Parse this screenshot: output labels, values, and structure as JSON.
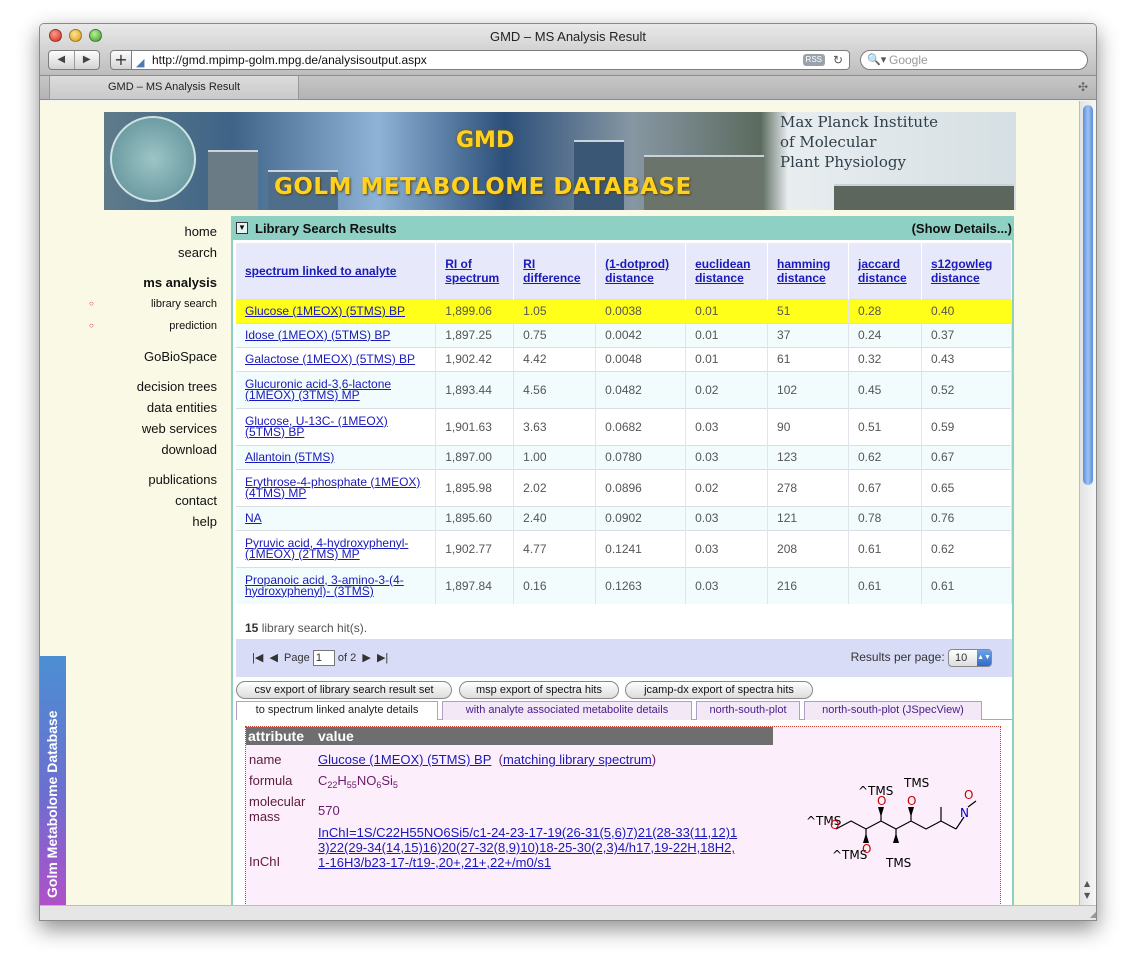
{
  "window": {
    "title": "GMD – MS Analysis Result",
    "url": "http://gmd.mpimp-golm.mpg.de/analysisoutput.aspx",
    "search_placeholder": "Google",
    "tab_label": "GMD – MS Analysis Result",
    "rss_label": "RSS"
  },
  "banner": {
    "title": "GMD",
    "subtitle": "GOLM METABOLOME DATABASE",
    "institute_line1": "Max Planck Institute",
    "institute_line2": "of Molecular",
    "institute_line3": "Plant Physiology"
  },
  "sidebar": {
    "items": [
      {
        "label": "home"
      },
      {
        "label": "search"
      },
      {
        "label": "ms analysis"
      },
      {
        "label": "library search"
      },
      {
        "label": "prediction"
      },
      {
        "label": "GoBioSpace"
      },
      {
        "label": "decision trees"
      },
      {
        "label": "data entities"
      },
      {
        "label": "web services"
      },
      {
        "label": "download"
      },
      {
        "label": "publications"
      },
      {
        "label": "contact"
      },
      {
        "label": "help"
      }
    ],
    "logo_text": "Golm Metabolome Database"
  },
  "results": {
    "panel_title": "Library Search Results",
    "show_details": "(Show Details...)",
    "columns": [
      "spectrum linked to analyte",
      "RI of spectrum",
      "RI difference",
      "(1-dotprod) distance",
      "euclidean distance",
      "hamming distance",
      "jaccard distance",
      "s12gowleg distance"
    ],
    "rows": [
      [
        "Glucose (1MEOX) (5TMS) BP",
        "1,899.06",
        "1.05",
        "0.0038",
        "0.01",
        "51",
        "0.28",
        "0.40"
      ],
      [
        "Idose (1MEOX) (5TMS) BP",
        "1,897.25",
        "0.75",
        "0.0042",
        "0.01",
        "37",
        "0.24",
        "0.37"
      ],
      [
        "Galactose (1MEOX) (5TMS) BP",
        "1,902.42",
        "4.42",
        "0.0048",
        "0.01",
        "61",
        "0.32",
        "0.43"
      ],
      [
        "Glucuronic acid-3,6-lactone (1MEOX) (3TMS) MP",
        "1,893.44",
        "4.56",
        "0.0482",
        "0.02",
        "102",
        "0.45",
        "0.52"
      ],
      [
        "Glucose, U-13C- (1MEOX) (5TMS) BP",
        "1,901.63",
        "3.63",
        "0.0682",
        "0.03",
        "90",
        "0.51",
        "0.59"
      ],
      [
        "Allantoin (5TMS)",
        "1,897.00",
        "1.00",
        "0.0780",
        "0.03",
        "123",
        "0.62",
        "0.67"
      ],
      [
        "Erythrose-4-phosphate (1MEOX) (4TMS) MP",
        "1,895.98",
        "2.02",
        "0.0896",
        "0.02",
        "278",
        "0.67",
        "0.65"
      ],
      [
        "NA",
        "1,895.60",
        "2.40",
        "0.0902",
        "0.03",
        "121",
        "0.78",
        "0.76"
      ],
      [
        "Pyruvic acid, 4-hydroxyphenyl- (1MEOX) (2TMS) MP",
        "1,902.77",
        "4.77",
        "0.1241",
        "0.03",
        "208",
        "0.61",
        "0.62"
      ],
      [
        "Propanoic acid, 3-amino-3-(4-hydroxyphenyl)- (3TMS)",
        "1,897.84",
        "0.16",
        "0.1263",
        "0.03",
        "216",
        "0.61",
        "0.61"
      ]
    ],
    "highlight_color": "#ffff1a",
    "hits_count": "15",
    "hits_text": "library search hit(s).",
    "pager": {
      "page_label": "Page",
      "page_value": "1",
      "of_label": "of 2",
      "results_per_page_label": "Results per page:",
      "results_per_page_value": "10"
    }
  },
  "exports": [
    "csv export of library search result set",
    "msp export of spectra hits",
    "jcamp-dx export of spectra hits"
  ],
  "subtabs": [
    "to spectrum linked analyte details",
    "with analyte associated metabolite details",
    "north-south-plot",
    "north-south-plot (JSpecView)"
  ],
  "details": {
    "header_attr": "attribute",
    "header_value": "value",
    "name_label": "name",
    "name_value": "Glucose (1MEOX) (5TMS) BP",
    "name_link": "matching library spectrum",
    "formula_label": "formula",
    "molecular_mass_label_1": "molecular",
    "molecular_mass_label_2": "mass",
    "molecular_mass_value": "570",
    "inchi_label": "InChI",
    "inchi_value": "InChI=1S/C22H55NO6Si5/c1-24-23-17-19(26-31(5,6)7)21(28-33(11,12)13)22(29-34(14,15)16)20(27-32(8,9)10)18-25-30(2,3)4/h17,19-22H,18H2,1-16H3/b23-17-/t19-,20+,21+,22+/m0/s1"
  },
  "structure_labels": [
    "^TMS",
    "O",
    "TMS",
    "O",
    "^TMS",
    "O",
    "N",
    "O",
    "^TMS",
    "O",
    "TMS"
  ]
}
